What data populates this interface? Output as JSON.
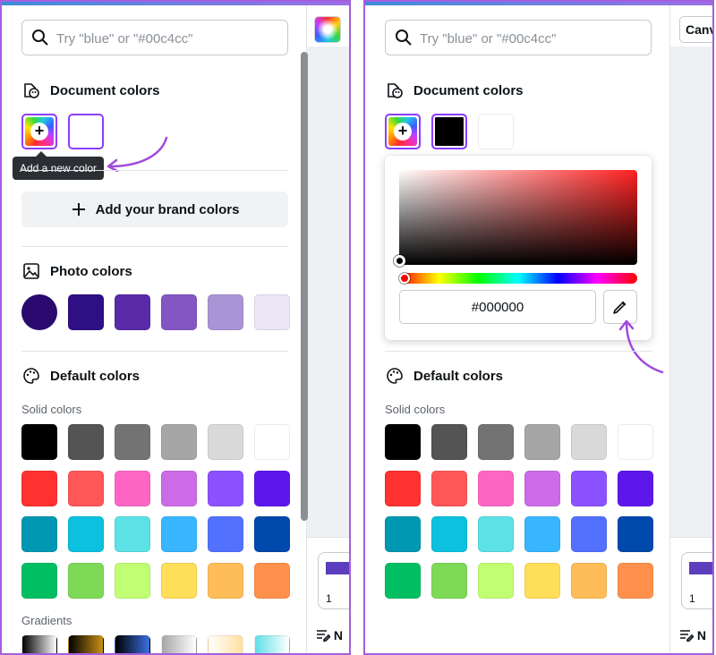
{
  "search": {
    "placeholder": "Try \"blue\" or \"#00c4cc\""
  },
  "sections": {
    "document_colors": "Document colors",
    "photo_colors": "Photo colors",
    "default_colors": "Default colors",
    "solid_colors": "Solid colors",
    "gradients": "Gradients"
  },
  "tooltip": "Add a new color",
  "brand_button": "Add your brand colors",
  "picker": {
    "hex_value": "#000000"
  },
  "side": {
    "canva_label": "Canv",
    "page_number": "1",
    "notes_label": "N"
  },
  "accent_color": "#8b3dff",
  "annotation_color": "#a24bd9",
  "left_document_swatches": [
    "#ffffff"
  ],
  "right_document_swatches": [
    "#000000",
    "#ffffff"
  ],
  "photo_swatches": [
    "#2a0a6e",
    "#2e0f84",
    "#5a2aa8",
    "#8356c3",
    "#a994d5",
    "#ebe6f6"
  ],
  "solid_swatches": [
    [
      "#000000",
      "#545454",
      "#737373",
      "#a6a6a6",
      "#d9d9d9",
      "#ffffff"
    ],
    [
      "#ff3131",
      "#ff5757",
      "#ff66c4",
      "#cb6ce6",
      "#8c52ff",
      "#5e17eb"
    ],
    [
      "#0097b2",
      "#0cc0df",
      "#5ce1e6",
      "#38b6ff",
      "#5271ff",
      "#004aad"
    ],
    [
      "#00bf63",
      "#7ed957",
      "#c1ff72",
      "#ffde59",
      "#ffbd59",
      "#ff914d"
    ]
  ],
  "gradient_swatches": [
    [
      "#000000",
      "#ffffff"
    ],
    [
      "#000000",
      "#c89116"
    ],
    [
      "#000000",
      "#3b6fe0"
    ],
    [
      "#a6a6a6",
      "#ffffff"
    ],
    [
      "#ffffff",
      "#ffe0a0"
    ],
    [
      "#5de0e6",
      "#ffffff"
    ]
  ]
}
